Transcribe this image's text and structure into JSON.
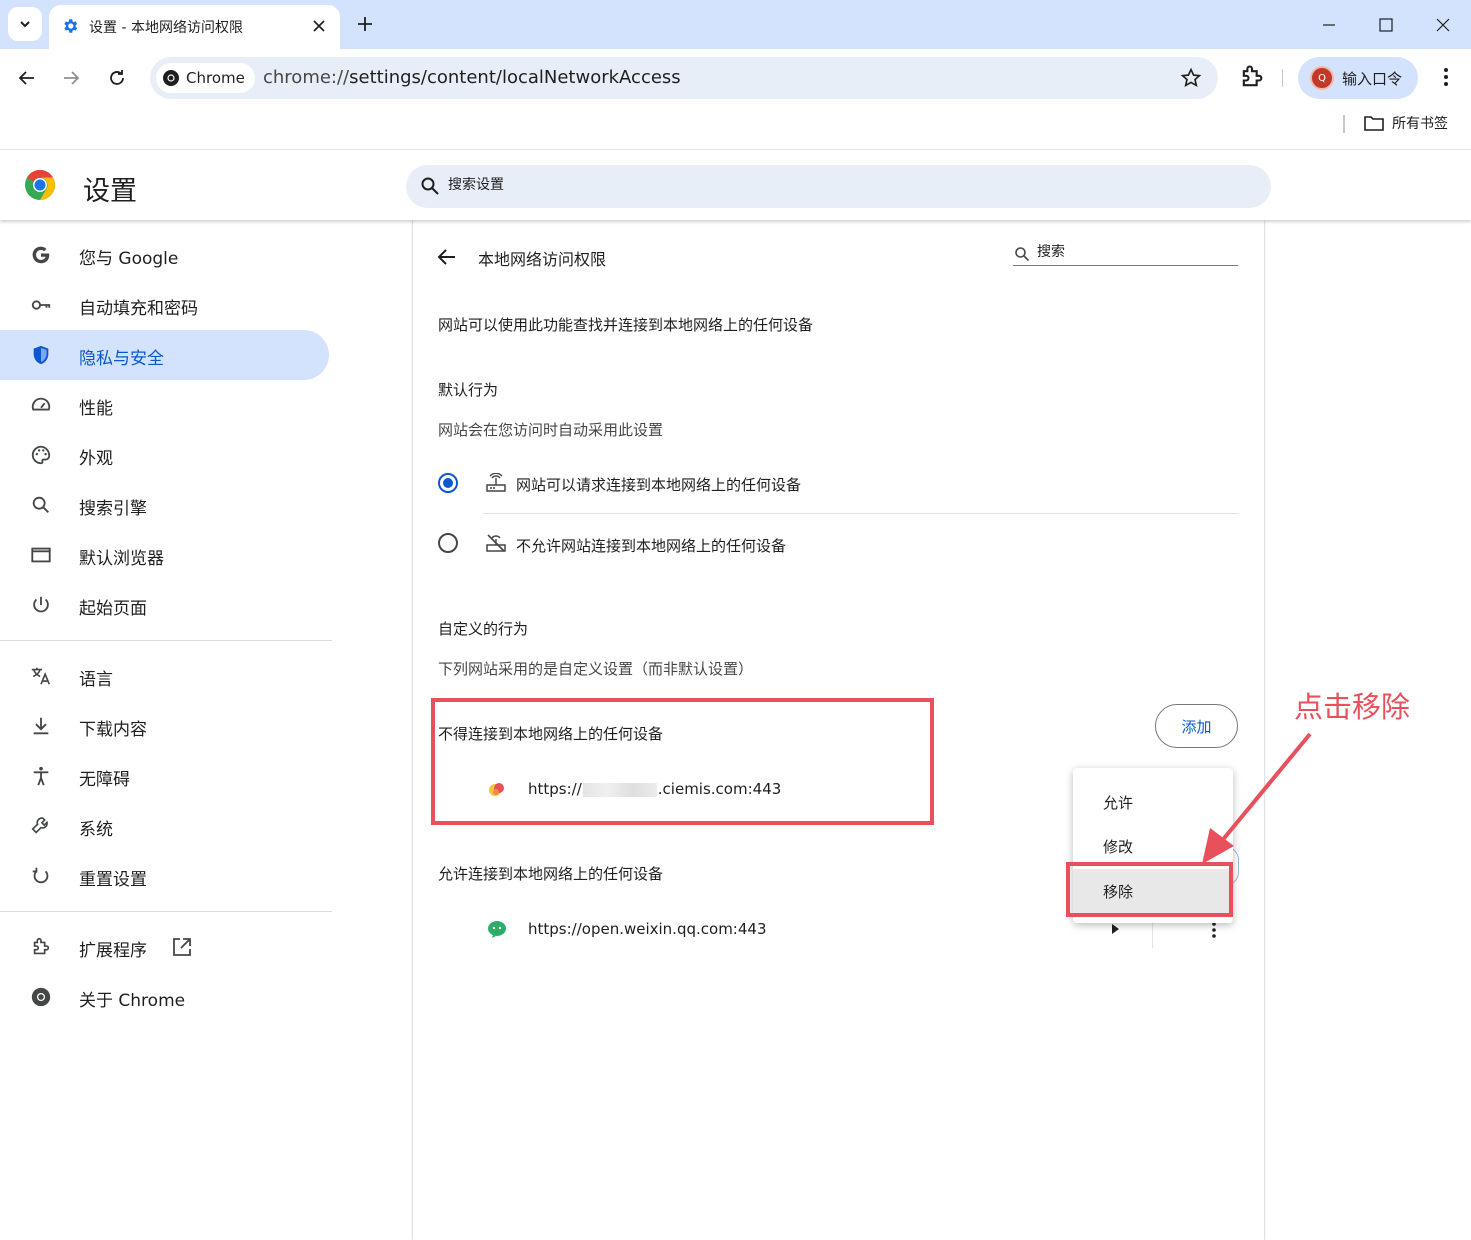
{
  "browser": {
    "tab": {
      "title": "设置 - 本地网络访问权限"
    },
    "omnibox": {
      "chip": "Chrome",
      "url_prefix": "chrome://",
      "url_main": "settings/content/localNetworkAccess"
    },
    "profile": {
      "label": "输入口令"
    },
    "bookmarks": {
      "folder": "所有书签"
    }
  },
  "settings": {
    "title": "设置",
    "search_placeholder": "搜索设置",
    "nav": [
      {
        "label": "您与 Google",
        "icon": "google-g-icon"
      },
      {
        "label": "自动填充和密码",
        "icon": "key-icon"
      },
      {
        "label": "隐私与安全",
        "icon": "shield-icon",
        "active": true
      },
      {
        "label": "性能",
        "icon": "speedometer-icon"
      },
      {
        "label": "外观",
        "icon": "palette-icon"
      },
      {
        "label": "搜索引擎",
        "icon": "search-icon"
      },
      {
        "label": "默认浏览器",
        "icon": "browser-window-icon"
      },
      {
        "label": "起始页面",
        "icon": "power-icon"
      },
      {
        "label": "语言",
        "icon": "translate-icon"
      },
      {
        "label": "下载内容",
        "icon": "download-icon"
      },
      {
        "label": "无障碍",
        "icon": "accessibility-icon"
      },
      {
        "label": "系统",
        "icon": "wrench-icon"
      },
      {
        "label": "重置设置",
        "icon": "reset-icon"
      },
      {
        "label": "扩展程序",
        "icon": "puzzle-icon"
      },
      {
        "label": "关于 Chrome",
        "icon": "chrome-icon"
      }
    ]
  },
  "page": {
    "title": "本地网络访问权限",
    "search_placeholder": "搜索",
    "description": "网站可以使用此功能查找并连接到本地网络上的任何设备",
    "default_behavior": {
      "heading": "默认行为",
      "subheading": "网站会在您访问时自动采用此设置",
      "options": [
        {
          "label": "网站可以请求连接到本地网络上的任何设备",
          "checked": true
        },
        {
          "label": "不允许网站连接到本地网络上的任何设备",
          "checked": false
        }
      ]
    },
    "custom_behavior": {
      "heading": "自定义的行为",
      "subheading": "下列网站采用的是自定义设置（而非默认设置）",
      "blocked": {
        "heading": "不得连接到本地网络上的任何设备",
        "add_label": "添加",
        "site_prefix": "https://",
        "site_suffix": ".ciemis.com:443"
      },
      "allowed": {
        "heading": "允许连接到本地网络上的任何设备",
        "site": "https://open.weixin.qq.com:443"
      }
    },
    "context_menu": [
      "允许",
      "修改",
      "移除"
    ]
  },
  "annotation": {
    "text": "点击移除",
    "color": "#e8505b"
  },
  "colors": {
    "accent": "#0b57d0",
    "active_nav_bg": "#d3e3fd",
    "titlebar": "#d3e3fd"
  }
}
